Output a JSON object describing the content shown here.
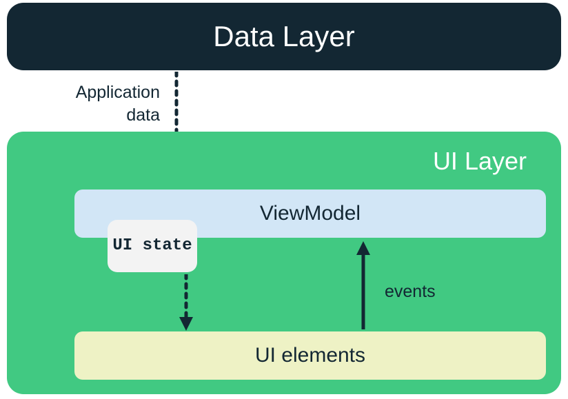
{
  "dataLayer": {
    "title": "Data Layer"
  },
  "applicationData": {
    "label": "Application data"
  },
  "uiLayer": {
    "title": "UI Layer",
    "viewModel": {
      "label": "ViewModel"
    },
    "uiState": {
      "label": "UI state"
    },
    "uiElements": {
      "label": "UI elements"
    },
    "events": {
      "label": "events"
    }
  },
  "colors": {
    "darkNavy": "#132733",
    "green": "#41c982",
    "lightBlue": "#d2e6f6",
    "lightYellow": "#eef2c5",
    "lightGray": "#f3f3f3"
  }
}
